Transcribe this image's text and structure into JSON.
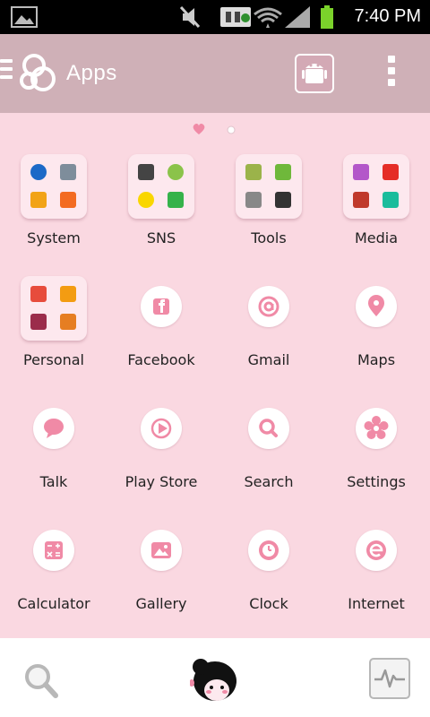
{
  "status_bar": {
    "time": "7:40 PM",
    "icons": [
      "picture-icon",
      "mute-icon",
      "usb-debug-icon",
      "wifi-icon",
      "signal-icon",
      "battery-icon"
    ]
  },
  "app_bar": {
    "title": "Apps",
    "icons": [
      "menu-icon",
      "go-logo-icon",
      "android-theme-icon",
      "overflow-menu-icon"
    ]
  },
  "page_indicator": {
    "pages": 2,
    "current": 1
  },
  "apps": [
    {
      "label": "System",
      "kind": "folder"
    },
    {
      "label": "SNS",
      "kind": "folder"
    },
    {
      "label": "Tools",
      "kind": "folder"
    },
    {
      "label": "Media",
      "kind": "folder"
    },
    {
      "label": "Personal",
      "kind": "folder"
    },
    {
      "label": "Facebook",
      "kind": "app",
      "icon": "facebook-icon"
    },
    {
      "label": "Gmail",
      "kind": "app",
      "icon": "at-sign-icon"
    },
    {
      "label": "Maps",
      "kind": "app",
      "icon": "map-pin-icon"
    },
    {
      "label": "Talk",
      "kind": "app",
      "icon": "chat-bubble-icon"
    },
    {
      "label": "Play Store",
      "kind": "app",
      "icon": "play-store-icon"
    },
    {
      "label": "Search",
      "kind": "app",
      "icon": "search-icon"
    },
    {
      "label": "Settings",
      "kind": "app",
      "icon": "flower-gear-icon"
    },
    {
      "label": "Calculator",
      "kind": "app",
      "icon": "calculator-icon"
    },
    {
      "label": "Gallery",
      "kind": "app",
      "icon": "picture-icon"
    },
    {
      "label": "Clock",
      "kind": "app",
      "icon": "clock-icon"
    },
    {
      "label": "Internet",
      "kind": "app",
      "icon": "browser-e-icon"
    }
  ],
  "dock": {
    "icons": [
      "search-icon",
      "mascot-icon",
      "pulse-icon"
    ]
  },
  "colors": {
    "background": "#fad8e1",
    "app_bar": "#cfb0b7",
    "accent_pink": "#f08aa6",
    "dock": "#ffffff"
  }
}
